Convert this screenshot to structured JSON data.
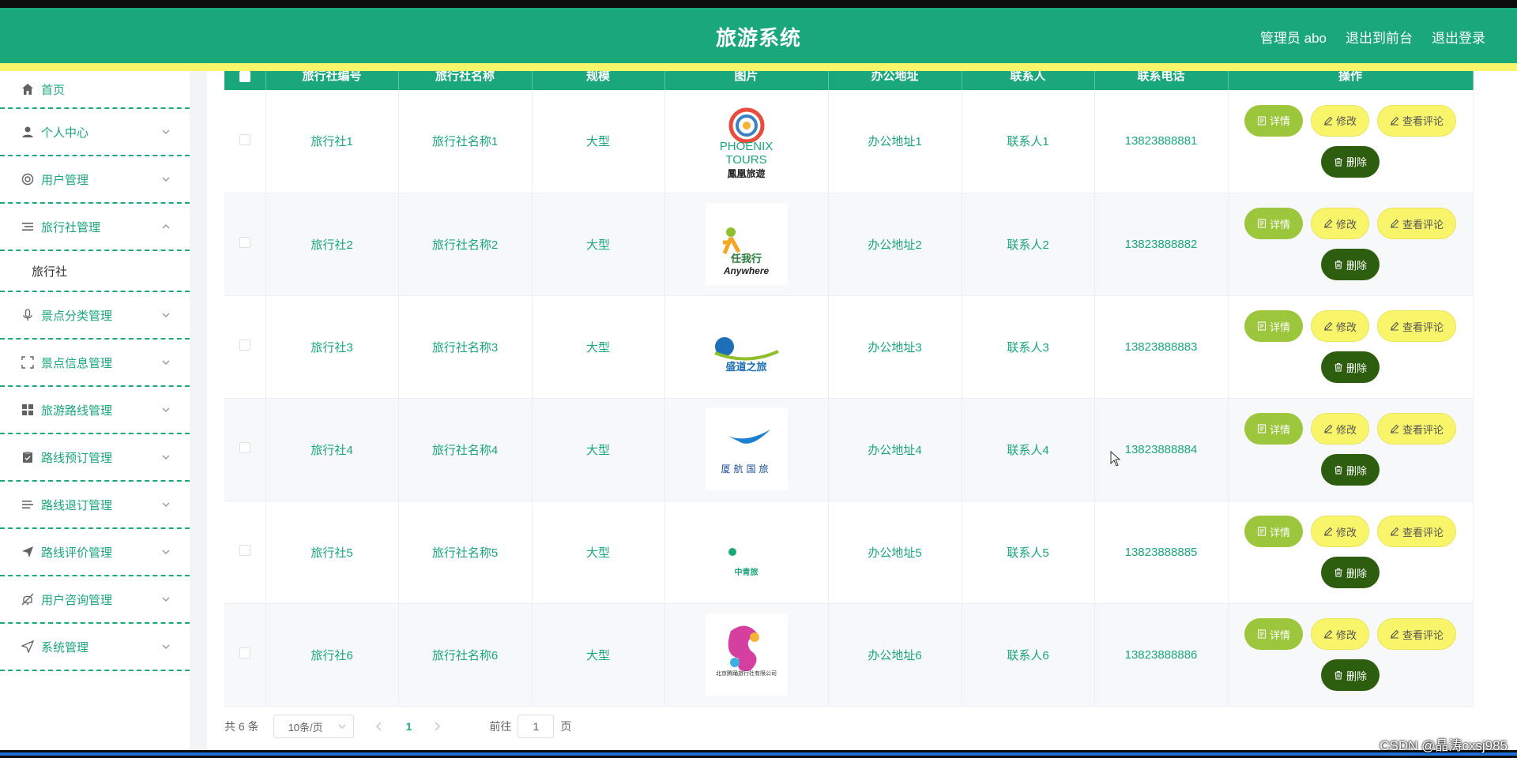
{
  "header": {
    "title": "旅游系统",
    "admin_label": "管理员 abo",
    "to_frontend": "退出到前台",
    "logout": "退出登录"
  },
  "sidebar": {
    "items": [
      {
        "label": "首页",
        "icon": "home-icon"
      },
      {
        "label": "个人中心",
        "icon": "user-icon"
      },
      {
        "label": "用户管理",
        "icon": "lifebuoy-icon"
      },
      {
        "label": "旅行社管理",
        "icon": "list-icon",
        "expanded": true
      },
      {
        "label": "旅行社",
        "sub": true
      },
      {
        "label": "景点分类管理",
        "icon": "microphone-icon"
      },
      {
        "label": "景点信息管理",
        "icon": "fullscreen-icon"
      },
      {
        "label": "旅游路线管理",
        "icon": "grid-icon"
      },
      {
        "label": "路线预订管理",
        "icon": "clipboard-icon"
      },
      {
        "label": "路线退订管理",
        "icon": "lines-icon"
      },
      {
        "label": "路线评价管理",
        "icon": "send-icon"
      },
      {
        "label": "用户咨询管理",
        "icon": "bell-off-icon"
      },
      {
        "label": "系统管理",
        "icon": "position-icon"
      }
    ]
  },
  "table": {
    "headers": [
      "旅行社编号",
      "旅行社名称",
      "规模",
      "图片",
      "办公地址",
      "联系人",
      "联系电话",
      "操作"
    ],
    "rows": [
      {
        "code": "旅行社1",
        "name": "旅行社名称1",
        "scale": "大型",
        "logo_text": "PHOENIX TOURS",
        "logo_sub": "鳳凰旅遊",
        "address": "办公地址1",
        "contact": "联系人1",
        "phone": "13823888881"
      },
      {
        "code": "旅行社2",
        "name": "旅行社名称2",
        "scale": "大型",
        "logo_text": "任我行",
        "logo_sub": "Anywhere",
        "address": "办公地址2",
        "contact": "联系人2",
        "phone": "13823888882"
      },
      {
        "code": "旅行社3",
        "name": "旅行社名称3",
        "scale": "大型",
        "logo_text": "盛道之旅",
        "logo_sub": "",
        "address": "办公地址3",
        "contact": "联系人3",
        "phone": "13823888883"
      },
      {
        "code": "旅行社4",
        "name": "旅行社名称4",
        "scale": "大型",
        "logo_text": "厦航国旅",
        "logo_sub": "",
        "address": "办公地址4",
        "contact": "联系人4",
        "phone": "13823888884"
      },
      {
        "code": "旅行社5",
        "name": "旅行社名称5",
        "scale": "大型",
        "logo_text": "中青旅",
        "logo_sub": "",
        "address": "办公地址5",
        "contact": "联系人5",
        "phone": "13823888885"
      },
      {
        "code": "旅行社6",
        "name": "旅行社名称6",
        "scale": "大型",
        "logo_text": "北京腾踊旅行社有限公司",
        "logo_sub": "",
        "address": "办公地址6",
        "contact": "联系人6",
        "phone": "13823888886"
      }
    ],
    "actions": {
      "detail": "详情",
      "edit": "修改",
      "review": "查看评论",
      "delete": "删除"
    }
  },
  "pagination": {
    "total": "共 6 条",
    "page_size": "10条/页",
    "current_page": "1",
    "goto_prefix": "前往",
    "goto_value": "1",
    "goto_suffix": "页"
  },
  "watermark": "CSDN @晶涛cxsj985",
  "colors": {
    "primary": "#1aa779",
    "accent_yellow": "#f8f56b",
    "detail_green": "#9cc63c",
    "delete_dark": "#2d5d0f"
  }
}
